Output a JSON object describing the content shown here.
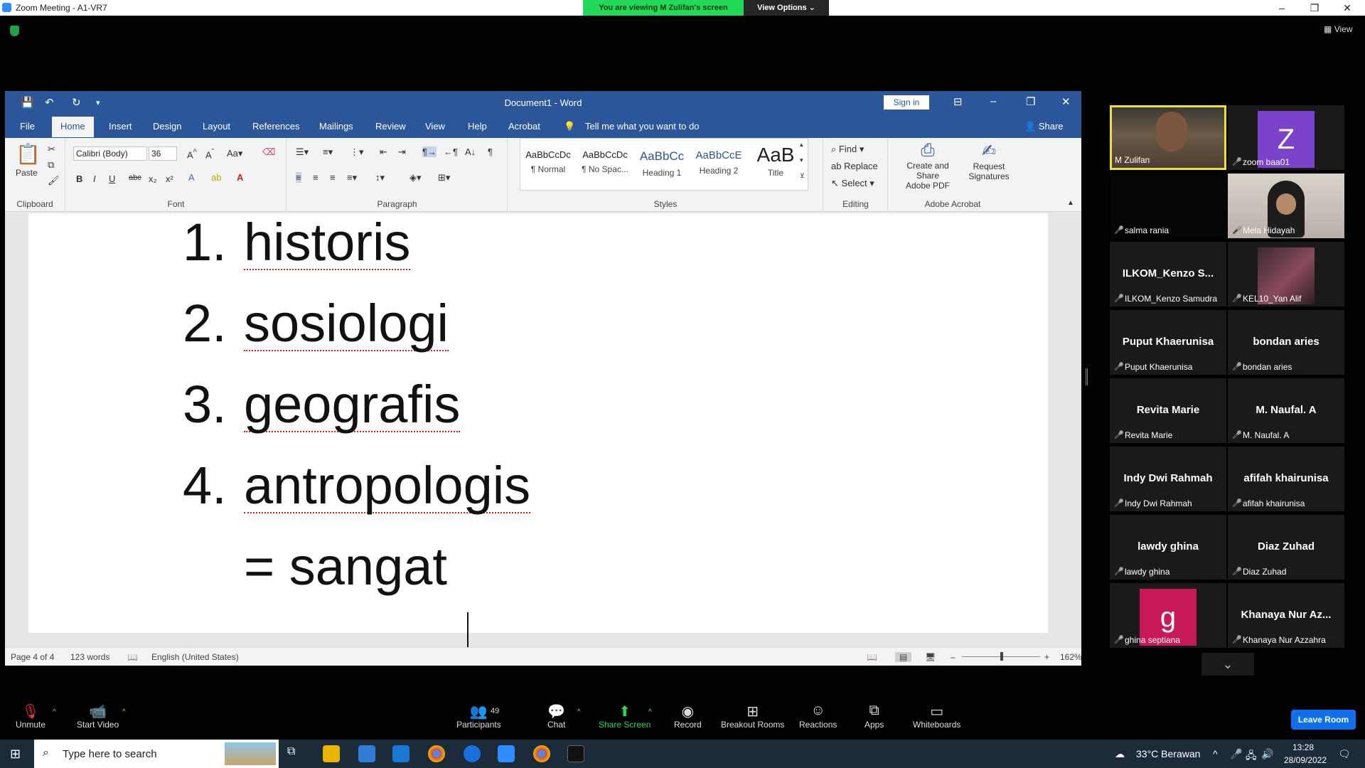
{
  "zoom": {
    "window_title": "Zoom Meeting - A1-VR7",
    "viewing_banner": "You are viewing M Zulifan's screen",
    "view_options": "View Options",
    "view_label": "View",
    "leave_label": "Leave Room",
    "toolbar": {
      "unmute": "Unmute",
      "start_video": "Start Video",
      "participants": "Participants",
      "participant_count": "49",
      "chat": "Chat",
      "share_screen": "Share Screen",
      "record": "Record",
      "breakout_rooms": "Breakout Rooms",
      "reactions": "Reactions",
      "apps": "Apps",
      "whiteboards": "Whiteboards"
    },
    "participants": [
      {
        "name": "M Zulifan",
        "type": "video",
        "active_speaker": true
      },
      {
        "name": "zoom baa01",
        "type": "avatar",
        "avatar_letter": "Z",
        "avatar_color": "#7b43c9"
      },
      {
        "name": "salma rania",
        "type": "dark"
      },
      {
        "name": "Mela Hidayah",
        "type": "video"
      },
      {
        "name": "ILKOM_Kenzo Samudra",
        "type": "text",
        "display": "ILKOM_Kenzo  S..."
      },
      {
        "name": "KEL10_Yan Alif",
        "type": "video"
      },
      {
        "name": "Puput Khaerunisa",
        "type": "text",
        "display": "Puput Khaerunisa"
      },
      {
        "name": "bondan aries",
        "type": "text",
        "display": "bondan aries"
      },
      {
        "name": "Revita Marie",
        "type": "text",
        "display": "Revita Marie"
      },
      {
        "name": "M. Naufal. A",
        "type": "text",
        "display": "M. Naufal. A"
      },
      {
        "name": "Indy Dwi Rahmah",
        "type": "text",
        "display": "Indy Dwi Rahmah"
      },
      {
        "name": "afifah khairunisa",
        "type": "text",
        "display": "afifah khairunisa"
      },
      {
        "name": "lawdy ghina",
        "type": "text",
        "display": "lawdy ghina"
      },
      {
        "name": "Diaz Zuhad",
        "type": "text",
        "display": "Diaz Zuhad"
      },
      {
        "name": "ghina septiana",
        "type": "avatar",
        "avatar_letter": "g",
        "avatar_color": "#c8195a"
      },
      {
        "name": "Khanaya Nur Azzahra",
        "type": "text",
        "display": "Khanaya Nur Az..."
      }
    ]
  },
  "word": {
    "doc_title": "Document1  -  Word",
    "sign_in": "Sign in",
    "share": "Share",
    "tell_me": "Tell me what you want to do",
    "tabs": [
      "File",
      "Home",
      "Insert",
      "Design",
      "Layout",
      "References",
      "Mailings",
      "Review",
      "View",
      "Help",
      "Acrobat"
    ],
    "active_tab": "Home",
    "font_name": "Calibri (Body)",
    "font_size": "36",
    "paste": "Paste",
    "groups": {
      "clipboard": "Clipboard",
      "font": "Font",
      "paragraph": "Paragraph",
      "styles": "Styles",
      "editing": "Editing",
      "acrobat": "Adobe Acrobat"
    },
    "styles": [
      {
        "preview": "AaBbCcDc",
        "name": "¶ Normal"
      },
      {
        "preview": "AaBbCcDc",
        "name": "¶ No Spac..."
      },
      {
        "preview": "AaBbCc",
        "name": "Heading 1"
      },
      {
        "preview": "AaBbCcE",
        "name": "Heading 2"
      },
      {
        "preview": "AaB",
        "name": "Title"
      }
    ],
    "editing": {
      "find": "Find",
      "replace": "Replace",
      "select": "Select"
    },
    "acrobat": {
      "create": "Create and Share",
      "create2": "Adobe PDF",
      "request": "Request",
      "request2": "Signatures"
    },
    "document_lines": [
      {
        "num": "1.",
        "text": "historis"
      },
      {
        "num": "2.",
        "text": "sosiologi"
      },
      {
        "num": "3.",
        "text": "geografis"
      },
      {
        "num": "4.",
        "text": "antropologis"
      }
    ],
    "last_line": "= sangat",
    "status": {
      "page": "Page 4 of 4",
      "words": "123 words",
      "language": "English (United States)",
      "zoom": "162%"
    }
  },
  "taskbar": {
    "search_placeholder": "Type here to search",
    "weather": "33°C  Berawan",
    "time": "13:28",
    "date": "28/09/2022"
  }
}
